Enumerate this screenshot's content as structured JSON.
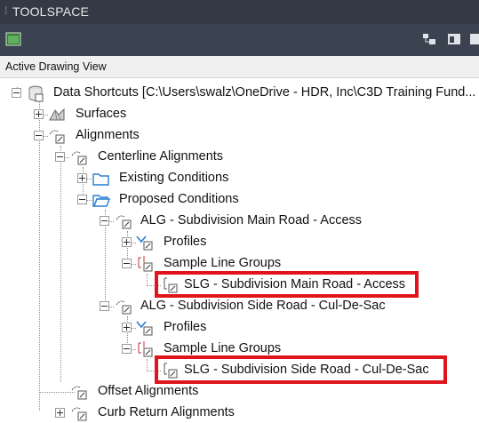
{
  "panel": {
    "title": "TOOLSPACE"
  },
  "toolbar": {
    "left_icon": "prospector-icon",
    "right_icons": [
      "tree-view-icon",
      "panel-icon",
      "options-icon"
    ]
  },
  "view": {
    "label": "Active Drawing View"
  },
  "tree": {
    "data_shortcuts": "Data Shortcuts [C:\\Users\\swalz\\OneDrive - HDR, Inc\\C3D Training Fund...",
    "surfaces": "Surfaces",
    "alignments": "Alignments",
    "centerline_alignments": "Centerline Alignments",
    "existing_conditions": "Existing Conditions",
    "proposed_conditions": "Proposed Conditions",
    "alg_main": "ALG - Subdivision Main Road - Access",
    "profiles_main": "Profiles",
    "slg_groups_main": "Sample Line Groups",
    "slg_main": "SLG - Subdivision Main Road - Access",
    "alg_side": "ALG - Subdivision Side Road - Cul-De-Sac",
    "profiles_side": "Profiles",
    "slg_groups_side": "Sample Line Groups",
    "slg_side": "SLG - Subdivision Side Road - Cul-De-Sac",
    "offset_alignments": "Offset Alignments",
    "curb_return_alignments": "Curb Return Alignments"
  },
  "colors": {
    "highlight": "#e0141c",
    "titlebar": "#343a45",
    "toolbar": "#3b4250"
  }
}
